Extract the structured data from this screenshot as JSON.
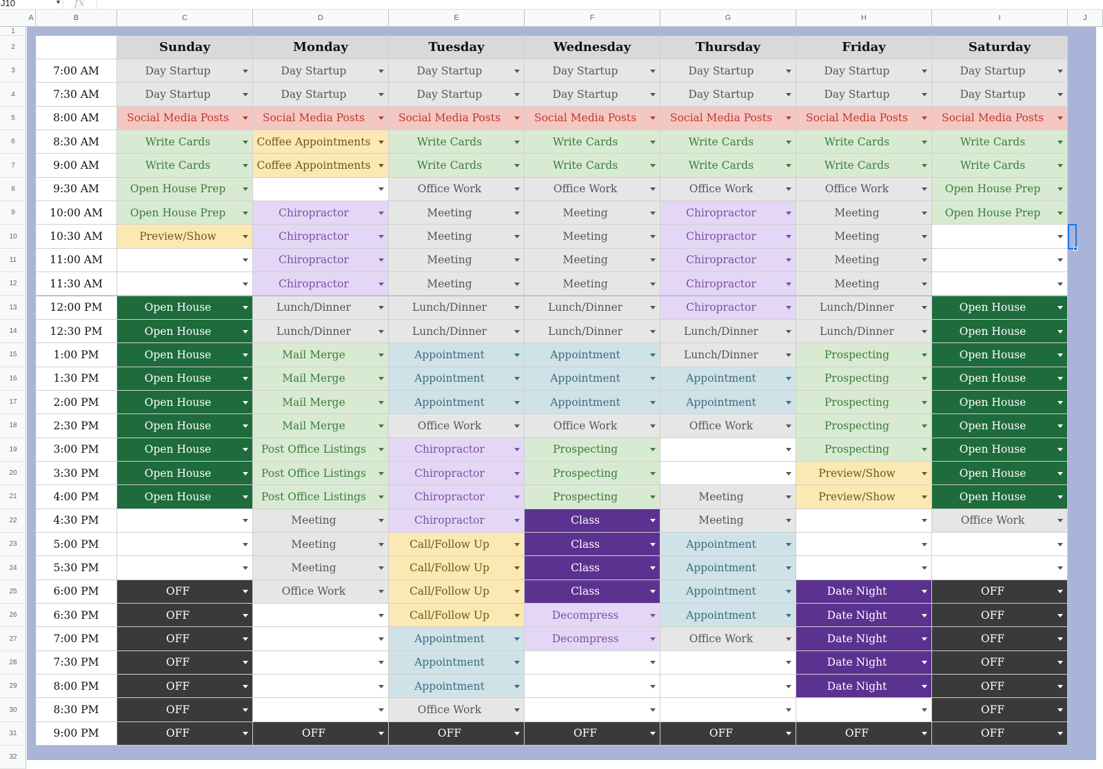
{
  "formula_bar": {
    "name_box": "J10",
    "fx": "fx"
  },
  "columns": [
    "A",
    "B",
    "C",
    "D",
    "E",
    "F",
    "G",
    "H",
    "I",
    "J"
  ],
  "rows": [
    "1",
    "2",
    "3",
    "4",
    "5",
    "6",
    "7",
    "8",
    "9",
    "10",
    "11",
    "12",
    "13",
    "14",
    "15",
    "16",
    "17",
    "18",
    "19",
    "20",
    "21",
    "22",
    "23",
    "24",
    "25",
    "26",
    "27",
    "28",
    "29",
    "30",
    "31",
    "32"
  ],
  "days": [
    "Sunday",
    "Monday",
    "Tuesday",
    "Wednesday",
    "Thursday",
    "Friday",
    "Saturday"
  ],
  "times": [
    "7:00 AM",
    "7:30 AM",
    "8:00 AM",
    "8:30 AM",
    "9:00 AM",
    "9:30 AM",
    "10:00 AM",
    "10:30 AM",
    "11:00 AM",
    "11:30 AM",
    "12:00 PM",
    "12:30 PM",
    "1:00 PM",
    "1:30 PM",
    "2:00 PM",
    "2:30 PM",
    "3:00 PM",
    "3:30 PM",
    "4:00 PM",
    "4:30 PM",
    "5:00 PM",
    "5:30 PM",
    "6:00 PM",
    "6:30 PM",
    "7:00 PM",
    "7:30 PM",
    "8:00 PM",
    "8:30 PM",
    "9:00 PM"
  ],
  "categories": {
    "Day Startup": {
      "bg": "#e6e6e6",
      "fg": "#555555"
    },
    "Social Media Posts": {
      "bg": "#f4c7c3",
      "fg": "#c0392b"
    },
    "Write Cards": {
      "bg": "#d9ead3",
      "fg": "#3a7d3a"
    },
    "Coffee Appointments": {
      "bg": "#fce8b2",
      "fg": "#6b5a1e"
    },
    "Office Work": {
      "bg": "#e6e6e6",
      "fg": "#555555"
    },
    "Open House Prep": {
      "bg": "#d9ead3",
      "fg": "#3a7d3a"
    },
    "Chiropractor": {
      "bg": "#e4d7f5",
      "fg": "#7a4fa8"
    },
    "Meeting": {
      "bg": "#e6e6e6",
      "fg": "#555555"
    },
    "Preview/Show": {
      "bg": "#fce8b2",
      "fg": "#6b5a1e"
    },
    "Open House": {
      "bg": "#1e6b3c",
      "fg": "#ffffff"
    },
    "Lunch/Dinner": {
      "bg": "#e6e6e6",
      "fg": "#555555"
    },
    "Mail Merge": {
      "bg": "#d9ead3",
      "fg": "#3a7d3a"
    },
    "Appointment": {
      "bg": "#cfe2e7",
      "fg": "#3d6b7d"
    },
    "Prospecting": {
      "bg": "#d9ead3",
      "fg": "#3a7d3a"
    },
    "Post Office Listings": {
      "bg": "#d9ead3",
      "fg": "#3a7d3a"
    },
    "Class": {
      "bg": "#5b3290",
      "fg": "#ffffff"
    },
    "Call/Follow Up": {
      "bg": "#fce8b2",
      "fg": "#6b5a1e"
    },
    "OFF": {
      "bg": "#3a3a3a",
      "fg": "#ffffff"
    },
    "Date Night": {
      "bg": "#5b3290",
      "fg": "#ffffff"
    },
    "Decompress": {
      "bg": "#e4d7f5",
      "fg": "#7a4fa8"
    },
    "": {
      "bg": "#ffffff",
      "fg": "#555555"
    }
  },
  "schedule": [
    [
      "Day Startup",
      "Day Startup",
      "Day Startup",
      "Day Startup",
      "Day Startup",
      "Day Startup",
      "Day Startup"
    ],
    [
      "Day Startup",
      "Day Startup",
      "Day Startup",
      "Day Startup",
      "Day Startup",
      "Day Startup",
      "Day Startup"
    ],
    [
      "Social Media Posts",
      "Social Media Posts",
      "Social Media Posts",
      "Social Media Posts",
      "Social Media Posts",
      "Social Media Posts",
      "Social Media Posts"
    ],
    [
      "Write Cards",
      "Coffee Appointments",
      "Write Cards",
      "Write Cards",
      "Write Cards",
      "Write Cards",
      "Write Cards"
    ],
    [
      "Write Cards",
      "Coffee Appointments",
      "Write Cards",
      "Write Cards",
      "Write Cards",
      "Write Cards",
      "Write Cards"
    ],
    [
      "Open House Prep",
      "",
      "Office Work",
      "Office Work",
      "Office Work",
      "Office Work",
      "Open House Prep"
    ],
    [
      "Open House Prep",
      "Chiropractor",
      "Meeting",
      "Meeting",
      "Chiropractor",
      "Meeting",
      "Open House Prep"
    ],
    [
      "Preview/Show",
      "Chiropractor",
      "Meeting",
      "Meeting",
      "Chiropractor",
      "Meeting",
      ""
    ],
    [
      "",
      "Chiropractor",
      "Meeting",
      "Meeting",
      "Chiropractor",
      "Meeting",
      ""
    ],
    [
      "",
      "Chiropractor",
      "Meeting",
      "Meeting",
      "Chiropractor",
      "Meeting",
      ""
    ],
    [
      "Open House",
      "Lunch/Dinner",
      "Lunch/Dinner",
      "Lunch/Dinner",
      "Chiropractor",
      "Lunch/Dinner",
      "Open House"
    ],
    [
      "Open House",
      "Lunch/Dinner",
      "Lunch/Dinner",
      "Lunch/Dinner",
      "Lunch/Dinner",
      "Lunch/Dinner",
      "Open House"
    ],
    [
      "Open House",
      "Mail Merge",
      "Appointment",
      "Appointment",
      "Lunch/Dinner",
      "Prospecting",
      "Open House"
    ],
    [
      "Open House",
      "Mail Merge",
      "Appointment",
      "Appointment",
      "Appointment",
      "Prospecting",
      "Open House"
    ],
    [
      "Open House",
      "Mail Merge",
      "Appointment",
      "Appointment",
      "Appointment",
      "Prospecting",
      "Open House"
    ],
    [
      "Open House",
      "Mail Merge",
      "Office Work",
      "Office Work",
      "Office Work",
      "Prospecting",
      "Open House"
    ],
    [
      "Open House",
      "Post Office Listings",
      "Chiropractor",
      "Prospecting",
      "",
      "Prospecting",
      "Open House"
    ],
    [
      "Open House",
      "Post Office Listings",
      "Chiropractor",
      "Prospecting",
      "",
      "Preview/Show",
      "Open House"
    ],
    [
      "Open House",
      "Post Office Listings",
      "Chiropractor",
      "Prospecting",
      "Meeting",
      "Preview/Show",
      "Open House"
    ],
    [
      "",
      "Meeting",
      "Chiropractor",
      "Class",
      "Meeting",
      "",
      "Office Work"
    ],
    [
      "",
      "Meeting",
      "Call/Follow Up",
      "Class",
      "Appointment",
      "",
      ""
    ],
    [
      "",
      "Meeting",
      "Call/Follow Up",
      "Class",
      "Appointment",
      "",
      ""
    ],
    [
      "OFF",
      "Office Work",
      "Call/Follow Up",
      "Class",
      "Appointment",
      "Date Night",
      "OFF"
    ],
    [
      "OFF",
      "",
      "Call/Follow Up",
      "Decompress",
      "Appointment",
      "Date Night",
      "OFF"
    ],
    [
      "OFF",
      "",
      "Appointment",
      "Decompress",
      "Office Work",
      "Date Night",
      "OFF"
    ],
    [
      "OFF",
      "",
      "Appointment",
      "",
      "",
      "Date Night",
      "OFF"
    ],
    [
      "OFF",
      "",
      "Appointment",
      "",
      "",
      "Date Night",
      "OFF"
    ],
    [
      "OFF",
      "",
      "Office Work",
      "",
      "",
      "",
      "OFF"
    ],
    [
      "OFF",
      "OFF",
      "OFF",
      "OFF",
      "OFF",
      "OFF",
      "OFF"
    ]
  ]
}
